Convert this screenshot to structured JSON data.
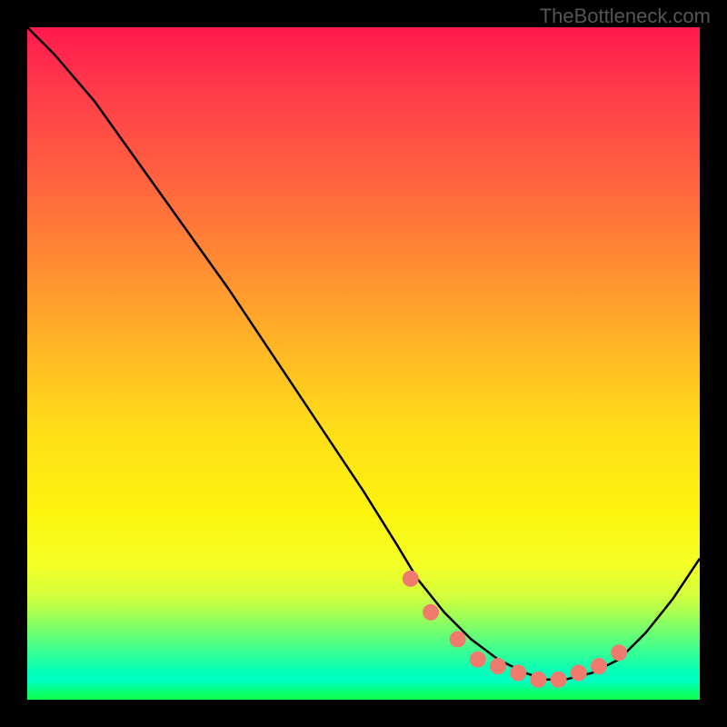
{
  "watermark": "TheBottleneck.com",
  "chart_data": {
    "type": "line",
    "title": "",
    "xlabel": "",
    "ylabel": "",
    "xlim": [
      0,
      1
    ],
    "ylim": [
      0,
      1
    ],
    "series": [
      {
        "name": "curve",
        "x": [
          0.0,
          0.04,
          0.1,
          0.2,
          0.3,
          0.4,
          0.5,
          0.55,
          0.58,
          0.62,
          0.66,
          0.7,
          0.74,
          0.77,
          0.8,
          0.84,
          0.88,
          0.92,
          0.96,
          1.0
        ],
        "y": [
          1.0,
          0.96,
          0.89,
          0.75,
          0.61,
          0.46,
          0.31,
          0.23,
          0.18,
          0.13,
          0.09,
          0.06,
          0.04,
          0.03,
          0.03,
          0.04,
          0.06,
          0.1,
          0.15,
          0.21
        ]
      }
    ],
    "markers": {
      "name": "dots",
      "x": [
        0.57,
        0.6,
        0.64,
        0.67,
        0.7,
        0.73,
        0.76,
        0.79,
        0.82,
        0.85,
        0.88
      ],
      "y": [
        0.18,
        0.13,
        0.09,
        0.06,
        0.05,
        0.04,
        0.03,
        0.03,
        0.04,
        0.05,
        0.07
      ],
      "color": "#ef7a6e"
    },
    "background": "red-yellow-green vertical gradient",
    "annotations": []
  }
}
